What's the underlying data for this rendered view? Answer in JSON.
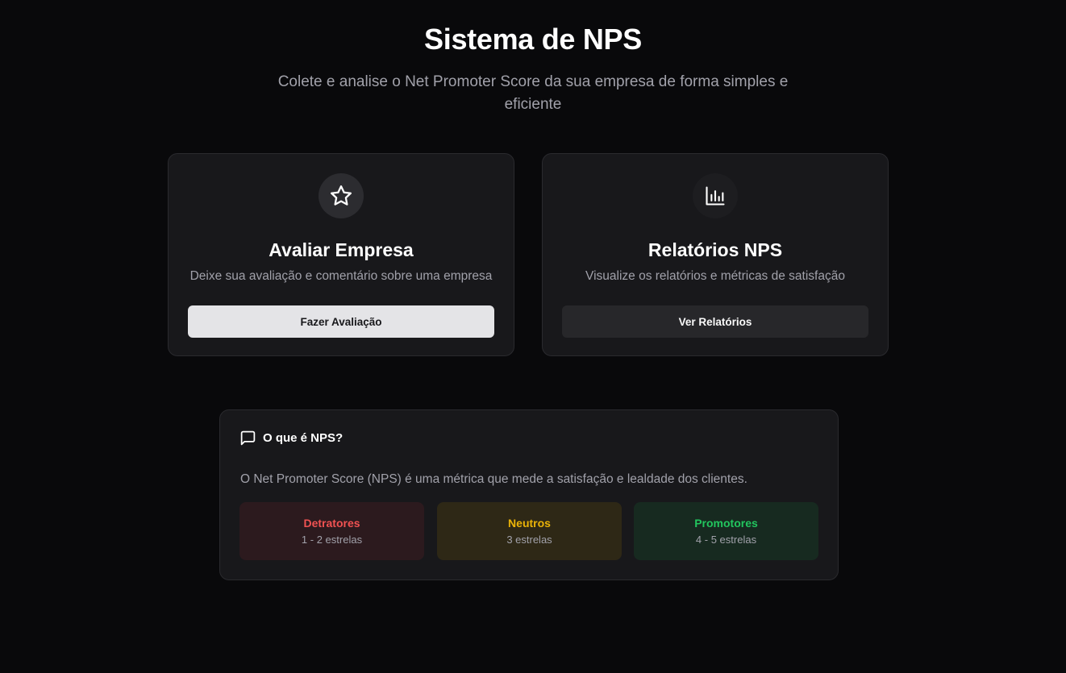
{
  "header": {
    "title": "Sistema de NPS",
    "subtitle": "Colete e analise o Net Promoter Score da sua empresa de forma simples e eficiente"
  },
  "cards": [
    {
      "icon": "star-icon",
      "title": "Avaliar Empresa",
      "description": "Deixe sua avaliação e comentário sobre uma empresa",
      "button": "Fazer Avaliação"
    },
    {
      "icon": "bar-chart-icon",
      "title": "Relatórios NPS",
      "description": "Visualize os relatórios e métricas de satisfação",
      "button": "Ver Relatórios"
    }
  ],
  "info": {
    "icon": "message-square-icon",
    "title": "O que é NPS?",
    "text": "O Net Promoter Score (NPS) é uma métrica que mede a satisfação e lealdade dos clientes.",
    "categories": [
      {
        "name": "Detratores",
        "range": "1 - 2 estrelas",
        "color": "#f05252"
      },
      {
        "name": "Neutros",
        "range": "3 estrelas",
        "color": "#eab308"
      },
      {
        "name": "Promotores",
        "range": "4 - 5 estrelas",
        "color": "#22c55e"
      }
    ]
  },
  "colors": {
    "background": "#09090b",
    "card": "#18181b",
    "primary_button": "#e4e4e7",
    "secondary_button": "#27272a"
  }
}
